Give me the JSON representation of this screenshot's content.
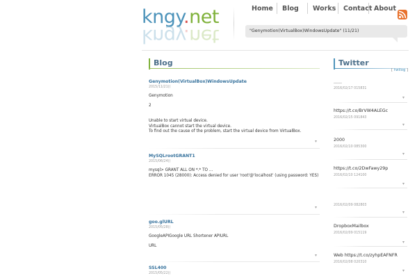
{
  "site": {
    "logo_main": "kngy",
    "logo_dot": ".",
    "logo_tld": "net"
  },
  "nav": {
    "items": [
      {
        "label": "Home"
      },
      {
        "label": "Blog"
      },
      {
        "label": "Works"
      },
      {
        "label": "Contact"
      },
      {
        "label": "About"
      }
    ],
    "rss_icon": "rss-icon"
  },
  "ticker": {
    "text": "\"Genymotion(VirtualBox)WindowsUpdate\"  (11/21)"
  },
  "blog": {
    "heading": "Blog",
    "more_marker": "▾",
    "posts": [
      {
        "title": "Genymotion(VirtualBox)WindowsUpdate",
        "date": "2015/11/21()",
        "paragraphs": [
          [
            "Genymotion"
          ],
          [
            "2"
          ],
          [
            "Unable to start virtual device.",
            "VirtualBox cannot start the virtual device.",
            "To find out the cause of the problem, start the virtual device from VirtualBox."
          ]
        ]
      },
      {
        "title": "MySQLrootGRANT1",
        "date": "2015/06/24()",
        "paragraphs": [
          [
            "mysql> GRANT ALL ON *.* TO ...",
            "ERROR 1045 (28000): Access denied for user 'root'@'localhost' (using password: YES)"
          ]
        ]
      },
      {
        "title": "goo.glURL",
        "date": "2015/05/28()",
        "paragraphs": [
          [
            "GoogleAPIGoogle URL Shortener APIURL"
          ],
          [
            "URL"
          ]
        ]
      },
      {
        "title": "SSL400",
        "date": "2015/05/22()",
        "paragraphs": []
      }
    ]
  },
  "twitter": {
    "heading": "Twitter",
    "link_open": "[",
    "link_label": "twilog",
    "link_close": "]",
    "tweets": [
      {
        "text": "......",
        "date": "2016/02/17 015831"
      },
      {
        "text": "https://t.co/BrVW4ALEGc",
        "date": "2016/02/15 091843"
      },
      {
        "text": "2000",
        "date": "2016/02/10 085300"
      },
      {
        "text": "https://t.co/2DwFawy29p",
        "date": "2016/02/10 124100"
      },
      {
        "text": "",
        "date": "2016/02/09 082803"
      },
      {
        "text": "DropboxMailbox",
        "date": "2016/02/09 015119"
      },
      {
        "text": "Web https://t.co/zyhpEAFNFR",
        "date": "2016/02/08 020310"
      }
    ]
  }
}
